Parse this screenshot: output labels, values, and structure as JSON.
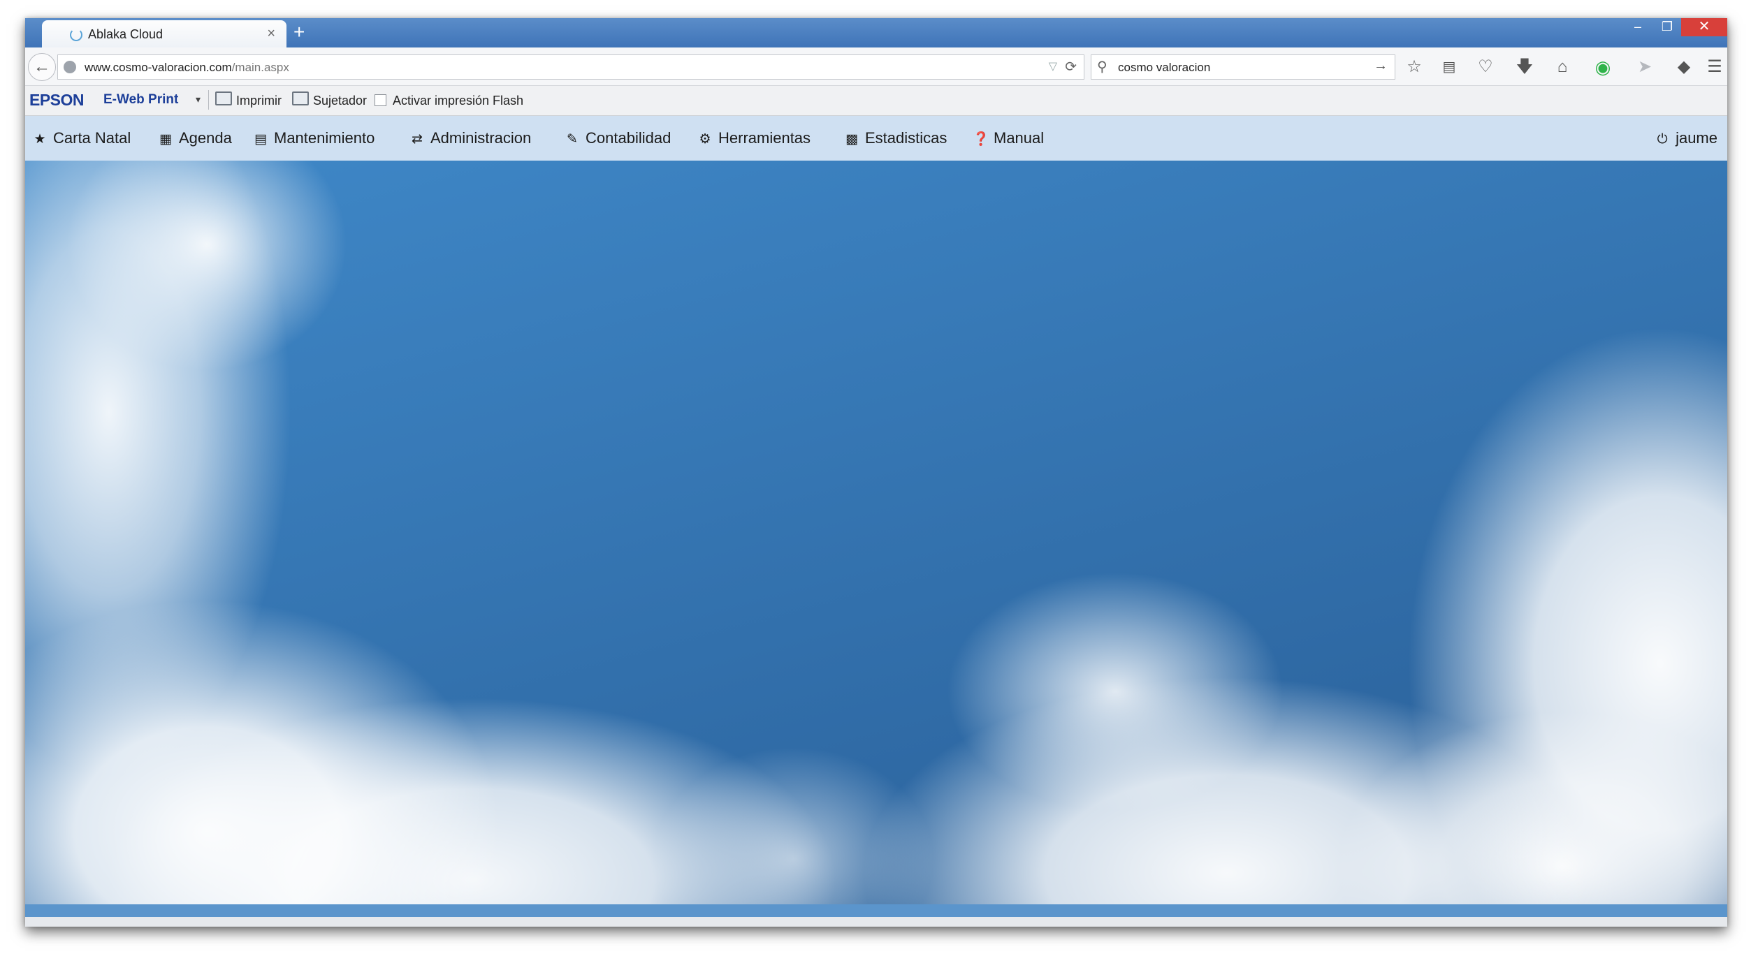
{
  "browser": {
    "tab_title": "Ablaka Cloud",
    "tab_close": "×",
    "new_tab": "+",
    "url_domain": "www.cosmo-valoracion.com",
    "url_path": "/main.aspx",
    "search_text": "cosmo valoracion",
    "window_controls": {
      "minimize": "–",
      "maximize": "❐",
      "close": "✕"
    },
    "icons": [
      "bookmark-star-icon",
      "reading-list-icon",
      "pocket-icon",
      "download-icon",
      "home-icon",
      "green-circle-addon-icon",
      "send-icon",
      "kite-icon",
      "menu-icon"
    ]
  },
  "epson": {
    "logo": "EPSON",
    "product": "E-Web Print",
    "print_label": "Imprimir",
    "clip_label": "Sujetador",
    "flash_label": "Activar impresión Flash",
    "flash_checked": false
  },
  "menu": {
    "items": [
      {
        "label": "Carta Natal",
        "icon": "star-icon"
      },
      {
        "label": "Agenda",
        "icon": "calendar-icon"
      },
      {
        "label": "Mantenimiento",
        "icon": "save-icon"
      },
      {
        "label": "Administracion",
        "icon": "exchange-icon"
      },
      {
        "label": "Contabilidad",
        "icon": "paperclip-icon"
      },
      {
        "label": "Herramientas",
        "icon": "cogs-icon"
      },
      {
        "label": "Estadisticas",
        "icon": "bar-chart-icon"
      },
      {
        "label": "Manual",
        "icon": "question-circle-icon"
      }
    ],
    "user": "jaume"
  },
  "colors": {
    "tabstrip": "#4a80c0",
    "menu_bg": "#cfe0f2",
    "sky": "#3677b4",
    "statusbar": "#5b95cc",
    "epson_blue": "#1d3f99"
  }
}
